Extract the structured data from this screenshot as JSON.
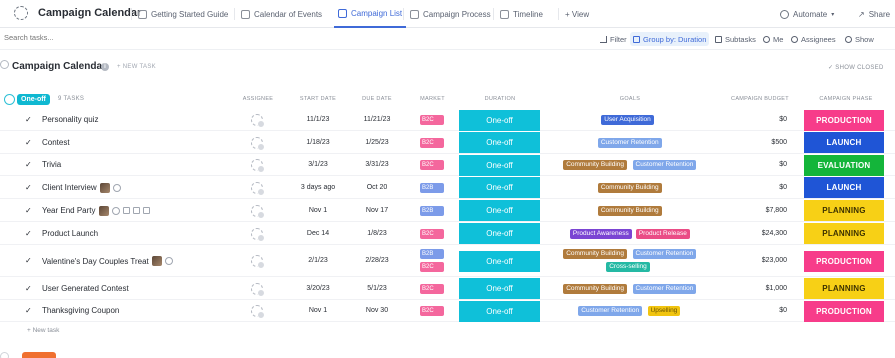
{
  "app": {
    "title": "Campaign Calendar"
  },
  "tabs": [
    {
      "label": "Getting Started Guide"
    },
    {
      "label": "Calendar of Events"
    },
    {
      "label": "Campaign List"
    },
    {
      "label": "Campaign Process"
    },
    {
      "label": "Timeline"
    },
    {
      "label": "+ View"
    }
  ],
  "top_actions": {
    "automate": "Automate",
    "share": "Share"
  },
  "toolbar": {
    "search_placeholder": "Search tasks...",
    "filter": "Filter",
    "group_by": "Group by: Duration",
    "subtasks": "Subtasks",
    "me": "Me",
    "assignees": "Assignees",
    "show": "Show"
  },
  "list": {
    "title": "Campaign Calendar",
    "new_task": "+ NEW TASK",
    "show_closed": "SHOW CLOSED"
  },
  "group": {
    "label": "One-off",
    "count": "9 TASKS",
    "columns": {
      "assignee": "ASSIGNEE",
      "start_date": "START DATE",
      "due_date": "DUE DATE",
      "market": "MARKET",
      "duration": "DURATION",
      "goals": "GOALS",
      "budget": "CAMPAIGN BUDGET",
      "phase": "CAMPAIGN PHASE"
    }
  },
  "rows": [
    {
      "name": "Personality quiz",
      "start": "11/1/23",
      "due": "11/21/23",
      "market": [
        "B2C"
      ],
      "duration": "One-off",
      "goals": [
        [
          "User Acquisition"
        ]
      ],
      "budget": "$0",
      "phase": "PRODUCTION"
    },
    {
      "name": "Contest",
      "start": "1/18/23",
      "due": "1/25/23",
      "market": [
        "B2C"
      ],
      "duration": "One-off",
      "goals": [
        [
          "Customer Retention"
        ]
      ],
      "budget": "$500",
      "phase": "LAUNCH"
    },
    {
      "name": "Trivia",
      "start": "3/1/23",
      "due": "3/31/23",
      "market": [
        "B2C"
      ],
      "duration": "One-off",
      "goals": [
        [
          "Community Building",
          "Customer Retention"
        ]
      ],
      "budget": "$0",
      "phase": "EVALUATION"
    },
    {
      "name": "Client Interview",
      "start": "3 days ago",
      "due": "Oct 20",
      "market": [
        "B2B"
      ],
      "duration": "One-off",
      "goals": [
        [
          "Community Building"
        ]
      ],
      "budget": "$0",
      "phase": "LAUNCH"
    },
    {
      "name": "Year End Party",
      "start": "Nov 1",
      "due": "Nov 17",
      "market": [
        "B2B"
      ],
      "duration": "One-off",
      "goals": [
        [
          "Community Building"
        ]
      ],
      "budget": "$7,800",
      "phase": "PLANNING"
    },
    {
      "name": "Product Launch",
      "start": "Dec 14",
      "due": "1/8/23",
      "market": [
        "B2C"
      ],
      "duration": "One-off",
      "goals": [
        [
          "Product Awareness",
          "Product Release"
        ]
      ],
      "budget": "$24,300",
      "phase": "PLANNING"
    },
    {
      "name": "Valentine's Day Couples Treat",
      "start": "2/1/23",
      "due": "2/28/23",
      "market": [
        "B2B",
        "B2C"
      ],
      "duration": "One-off",
      "goals": [
        [
          "Community Building",
          "Customer Retention"
        ],
        [
          "Cross-selling"
        ]
      ],
      "budget": "$23,000",
      "phase": "PRODUCTION"
    },
    {
      "name": "User Generated Contest",
      "start": "3/20/23",
      "due": "5/1/23",
      "market": [
        "B2C"
      ],
      "duration": "One-off",
      "goals": [
        [
          "Community Building",
          "Customer Retention"
        ]
      ],
      "budget": "$1,000",
      "phase": "PLANNING"
    },
    {
      "name": "Thanksgiving Coupon",
      "start": "Nov 1",
      "due": "Nov 30",
      "market": [
        "B2C"
      ],
      "duration": "One-off",
      "goals": [
        [
          "Customer Retention",
          "Upselling"
        ]
      ],
      "budget": "$0",
      "phase": "PRODUCTION"
    }
  ],
  "new_task_bottom": "+ New task",
  "colors": {
    "duration": "#0fc0d9",
    "goal_colors": {
      "User Acquisition": "#3f6ad8",
      "Customer Retention": "#7fa7ea",
      "Community Building": "#b07b3c",
      "Product Awareness": "#7b45d3",
      "Product Release": "#ea4d86",
      "Cross-selling": "#25b9a4",
      "Upselling": "#f1c40f"
    },
    "phase_colors": {
      "PRODUCTION": "#f73c8a",
      "LAUNCH": "#1f55d6",
      "EVALUATION": "#14b53a",
      "PLANNING": "#f7d016"
    }
  },
  "icons": [
    "list-icon",
    "calendar-icon",
    "process-icon",
    "timeline-icon",
    "filter-icon",
    "group-icon",
    "subtasks-icon",
    "me-icon",
    "assignees-icon",
    "show-icon",
    "automate-icon",
    "share-icon"
  ]
}
